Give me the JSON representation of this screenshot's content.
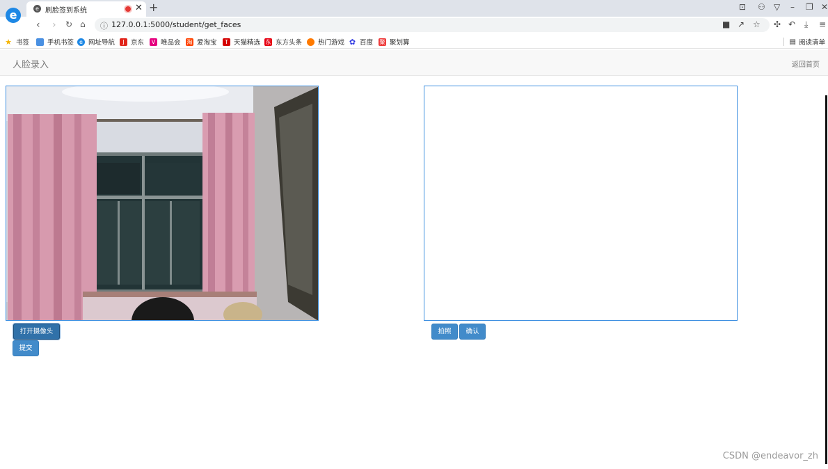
{
  "browser": {
    "tab_title": "刷脸签到系统",
    "url": "127.0.0.1:5000/student/get_faces",
    "bookmarks": [
      {
        "label": "书签",
        "icon": "star-icon",
        "color": "#f5b400"
      },
      {
        "label": "手机书签",
        "icon": "phone-bookmark-icon",
        "color": "#4a90e2"
      },
      {
        "label": "网址导航",
        "icon": "browser-e-icon",
        "color": "#1e88e5"
      },
      {
        "label": "京东",
        "icon": "jd-icon",
        "color": "#e1251b"
      },
      {
        "label": "唯品会",
        "icon": "vip-icon",
        "color": "#e5007f"
      },
      {
        "label": "爱淘宝",
        "icon": "aitaobao-icon",
        "color": "#ff4400"
      },
      {
        "label": "天猫精选",
        "icon": "tmall-icon",
        "color": "#d40000"
      },
      {
        "label": "东方头条",
        "icon": "dftt-icon",
        "color": "#e60012"
      },
      {
        "label": "热门游戏",
        "icon": "game-icon",
        "color": "#ff7a00"
      },
      {
        "label": "百度",
        "icon": "baidu-paw-icon",
        "color": "#2932e1"
      },
      {
        "label": "聚划算",
        "icon": "juhuasuan-icon",
        "color": "#ee3b3b"
      }
    ],
    "read_list": "阅读清单"
  },
  "navbar": {
    "brand": "人脸录入",
    "home_link": "返回首页"
  },
  "buttons": {
    "open_camera": "打开摄像头",
    "submit": "提交",
    "shoot": "拍照",
    "confirm": "确认"
  },
  "watermark": "CSDN @endeavor_zh",
  "colors": {
    "accent": "#428bca",
    "frame_border": "#3b8ee0"
  }
}
